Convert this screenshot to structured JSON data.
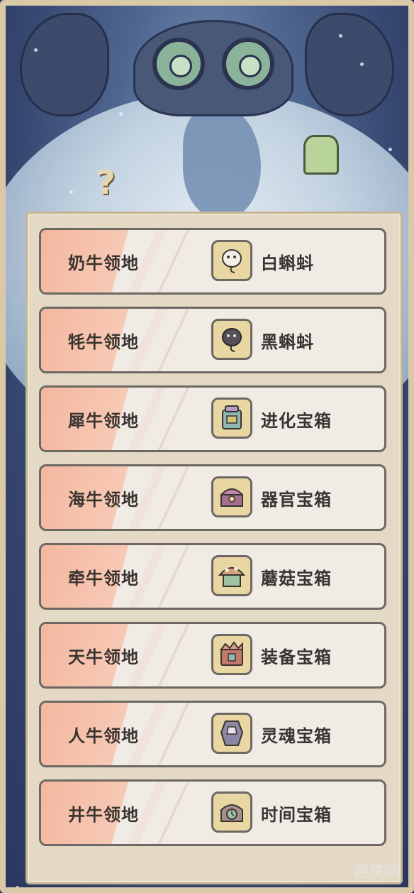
{
  "rows": [
    {
      "name": "奶牛领地",
      "reward": "白蝌蚪",
      "icon": "white-tadpole-icon"
    },
    {
      "name": "牦牛领地",
      "reward": "黑蝌蚪",
      "icon": "black-tadpole-icon"
    },
    {
      "name": "犀牛领地",
      "reward": "进化宝箱",
      "icon": "evolution-chest-icon"
    },
    {
      "name": "海牛领地",
      "reward": "器官宝箱",
      "icon": "organ-chest-icon"
    },
    {
      "name": "牵牛领地",
      "reward": "蘑菇宝箱",
      "icon": "mushroom-chest-icon"
    },
    {
      "name": "天牛领地",
      "reward": "装备宝箱",
      "icon": "equipment-chest-icon"
    },
    {
      "name": "人牛领地",
      "reward": "灵魂宝箱",
      "icon": "soul-chest-icon"
    },
    {
      "name": "井牛领地",
      "reward": "时间宝箱",
      "icon": "time-chest-icon"
    }
  ],
  "watermark": "游侠网",
  "colors": {
    "stripe": "#f4b79f",
    "row_bg": "#f1ebe6",
    "border": "#6d6863",
    "text": "#3a3431"
  }
}
